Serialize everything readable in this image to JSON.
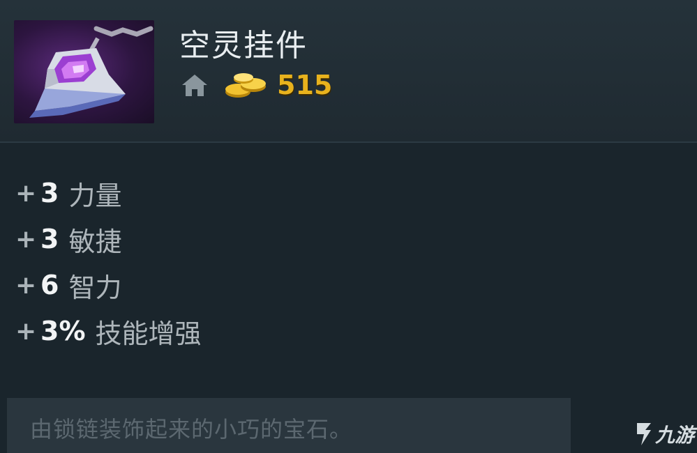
{
  "item": {
    "name": "空灵挂件",
    "cost": "515",
    "icon": "ethereal-pendant-icon"
  },
  "stats": [
    {
      "plus": "+",
      "value": "3",
      "label": "力量"
    },
    {
      "plus": "+",
      "value": "3",
      "label": "敏捷"
    },
    {
      "plus": "+",
      "value": "6",
      "label": "智力"
    },
    {
      "plus": "+",
      "value": "3%",
      "label": "技能增强"
    }
  ],
  "lore": "由锁链装饰起来的小巧的宝石。",
  "watermark": {
    "text": "九游"
  },
  "colors": {
    "gold": "#e8b21d",
    "title": "#e9eef1",
    "background": "#1a252c"
  }
}
